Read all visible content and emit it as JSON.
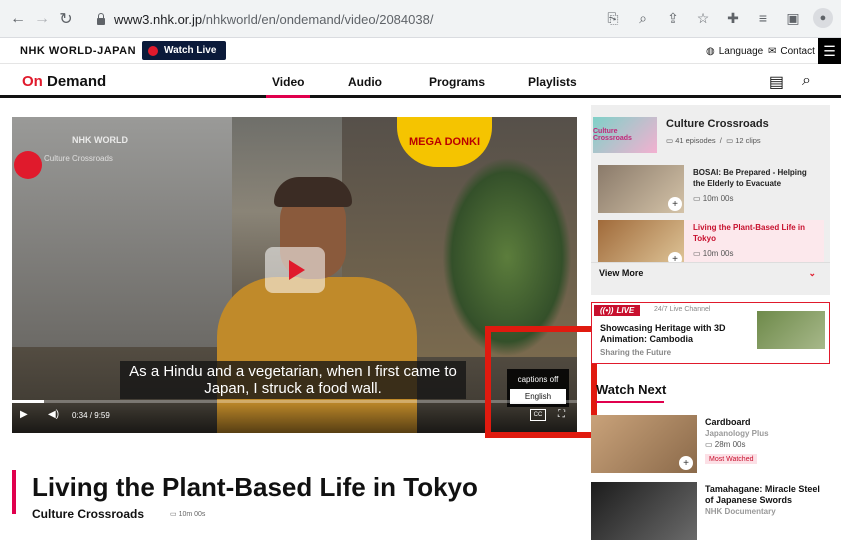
{
  "browser": {
    "url_host": "www3.nhk.or.jp",
    "url_path": "/nhkworld/en/ondemand/video/2084038/"
  },
  "topbar": {
    "logo": "NHK WORLD-JAPAN",
    "watch_live": "Watch Live",
    "language": "Language",
    "contact": "Contact"
  },
  "header": {
    "logo_on": "On",
    "logo_demand": " Demand",
    "tabs": [
      "Video",
      "Audio",
      "Programs",
      "Playlists"
    ]
  },
  "player": {
    "watermark": "NHK WORLD",
    "sub_watermark": "Culture Crossroads",
    "sign": "MEGA DONKI",
    "subtitle_line1": "As a Hindu and a vegetarian, when I first came to",
    "subtitle_line2": "Japan, I struck a food wall.",
    "time": "0:34 / 9:59",
    "progress": 0.057,
    "captions": [
      "captions off",
      "English"
    ],
    "selected_caption": "English"
  },
  "sidebar": {
    "series_title": "Culture Crossroads",
    "episodes_meta": "41 episodes",
    "clips_meta": "12 clips",
    "items": [
      {
        "title": "BOSAI: Be Prepared - Helping the Elderly to Evacuate",
        "duration": "10m 00s"
      },
      {
        "title": "Living the Plant-Based Life in Tokyo",
        "duration": "10m 00s"
      }
    ],
    "view_more": "View More"
  },
  "live": {
    "tag": "LIVE",
    "channel": "24/7 Live Channel",
    "title": "Showcasing Heritage with 3D Animation: Cambodia",
    "subtitle": "Sharing the Future"
  },
  "watch_next": {
    "title": "Watch Next",
    "items": [
      {
        "title": "Cardboard",
        "series": "Japanology Plus",
        "duration": "28m 00s",
        "badge": "Most Watched"
      },
      {
        "title": "Tamahagane: Miracle Steel of Japanese Swords",
        "series": "NHK Documentary"
      }
    ]
  },
  "main": {
    "title": "Living the Plant-Based Life in Tokyo",
    "series": "Culture Crossroads",
    "duration": "10m 00s"
  }
}
